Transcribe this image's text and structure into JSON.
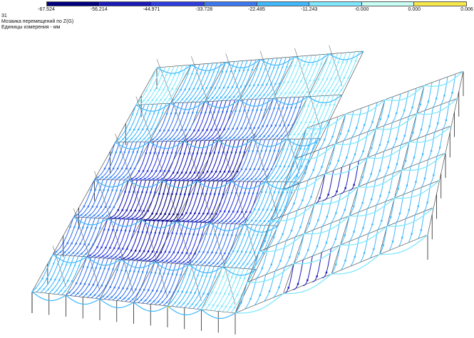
{
  "legend": {
    "colors": [
      "#00007f",
      "#1a1ab8",
      "#2e3de0",
      "#3c78f0",
      "#40b8ff",
      "#7fe8ff",
      "#c8fff4",
      "#f7e94a"
    ],
    "labels": [
      "-67.524",
      "-56.214",
      "-44.971",
      "-33.728",
      "-22.485",
      "-11.243",
      "-0.000",
      "0.000",
      "0.006"
    ]
  },
  "info": {
    "number": "31",
    "title": "Мозаика перемещений по Z(G)",
    "units": "Единицы измерения - мм"
  }
}
